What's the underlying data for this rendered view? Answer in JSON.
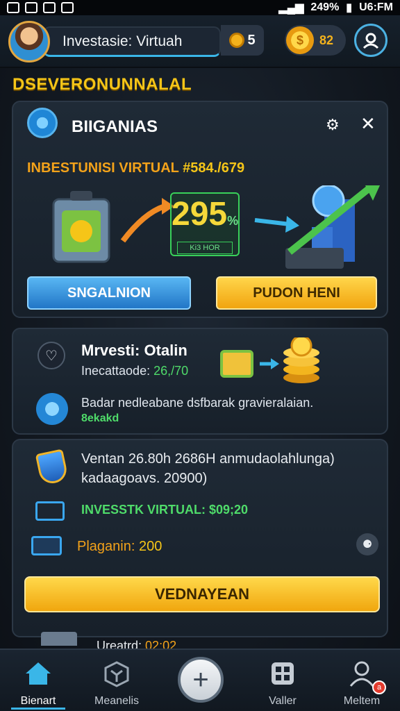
{
  "status_bar": {
    "battery": "249%",
    "time": "U6:FM"
  },
  "header": {
    "title": "Investasie: Virtuah",
    "gems": "5",
    "coins": "82",
    "coin_symbol": "$"
  },
  "section_heading": "DSEVERONUNNALAL",
  "card1": {
    "title": "BIIGANIAS",
    "invest_label": "INBESTUNISI VIRTUAL",
    "invest_value": "#584./679",
    "percent_value": "295",
    "percent_sign": "%",
    "percent_sub": "Ki3 HOR",
    "currency_mark": "₩",
    "button_left": "SNGALNION",
    "button_right": "PUDON HENI"
  },
  "card2": {
    "title": "Mrvesti: Otalin",
    "sub_label": "Inecattaode:",
    "sub_value": "26,/70",
    "description": "Badar nedleabane dsfbarak gravieralaian.",
    "description_tag": "8ekakd"
  },
  "card3": {
    "line1": "Ventan 26.80h  2686H anmudaolahlunga)",
    "line2": "kadaagoavs. 20900)",
    "invest_line": "INVESSTK VIRTUAL: $09;20",
    "plan_label": "Plaganin:",
    "plan_value": "200",
    "button": "VEDNAYEAN",
    "peek_label": "Ureatrd:",
    "peek_value": "02:02"
  },
  "bottom_nav": {
    "items": [
      {
        "label": "Bienart",
        "icon": "home-icon"
      },
      {
        "label": "Meanelis",
        "icon": "cube-icon"
      },
      {
        "label": "+",
        "icon": "plus-icon"
      },
      {
        "label": "Valler",
        "icon": "grid-icon"
      },
      {
        "label": "Meltem",
        "icon": "user-icon"
      }
    ],
    "notification_badge": "a"
  },
  "colors": {
    "accent_yellow": "#f5c518",
    "accent_blue": "#3ab6e8",
    "accent_green": "#4fdc6a",
    "background": "#121820"
  }
}
